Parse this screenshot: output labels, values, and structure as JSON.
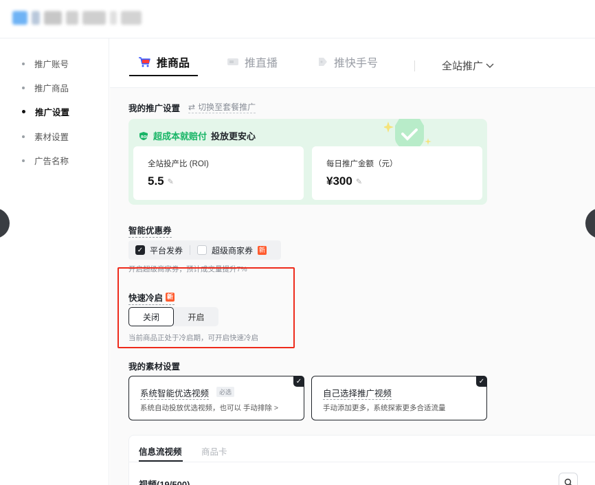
{
  "header": {
    "logo_blurred": true
  },
  "sidebar": {
    "items": [
      {
        "label": "推广账号"
      },
      {
        "label": "推广商品"
      },
      {
        "label": "推广设置"
      },
      {
        "label": "素材设置"
      },
      {
        "label": "广告名称"
      }
    ],
    "active_index": 2
  },
  "tabs": {
    "items": [
      {
        "label": "推商品",
        "icon": "cart-icon"
      },
      {
        "label": "推直播",
        "icon": "live-icon"
      },
      {
        "label": "推快手号",
        "icon": "tag-icon"
      }
    ],
    "dropdown_label": "全站推广",
    "active_index": 0
  },
  "promo_settings": {
    "title": "我的推广设置",
    "switch_link": "切换至套餐推广",
    "promo_highlight": "超成本就赔付",
    "promo_text": "投放更安心",
    "roi_label": "全站投产比 (ROI)",
    "roi_value": "5.5",
    "budget_label": "每日推广金额（元）",
    "budget_value": "¥300"
  },
  "coupon": {
    "title": "智能优惠券",
    "options": [
      {
        "label": "平台发券",
        "checked": true
      },
      {
        "label": "超级商家券",
        "checked": false,
        "badge": "新"
      }
    ],
    "hint": "开启超级商家券，预计成交量提升7%"
  },
  "fast_cold_start": {
    "title": "快速冷启",
    "badge": "新",
    "off_label": "关闭",
    "on_label": "开启",
    "selected": "关闭",
    "hint": "当前商品正处于冷启期，可开启快速冷启"
  },
  "materials": {
    "title": "我的素材设置",
    "cards": [
      {
        "title": "系统智能优选视频",
        "tag": "必选",
        "desc": "系统自动投放优选视频，也可以 手动排除 >"
      },
      {
        "title": "自己选择推广视频",
        "desc": "手动添加更多，系统探索更多合适流量"
      }
    ]
  },
  "video_panel": {
    "tabs": [
      "信息流视频",
      "商品卡"
    ],
    "count_label": "视频(19/500)"
  },
  "colors": {
    "accent_green": "#18b566",
    "highlight_red": "#ee2a1a",
    "new_tag": "#ff5b2e"
  }
}
